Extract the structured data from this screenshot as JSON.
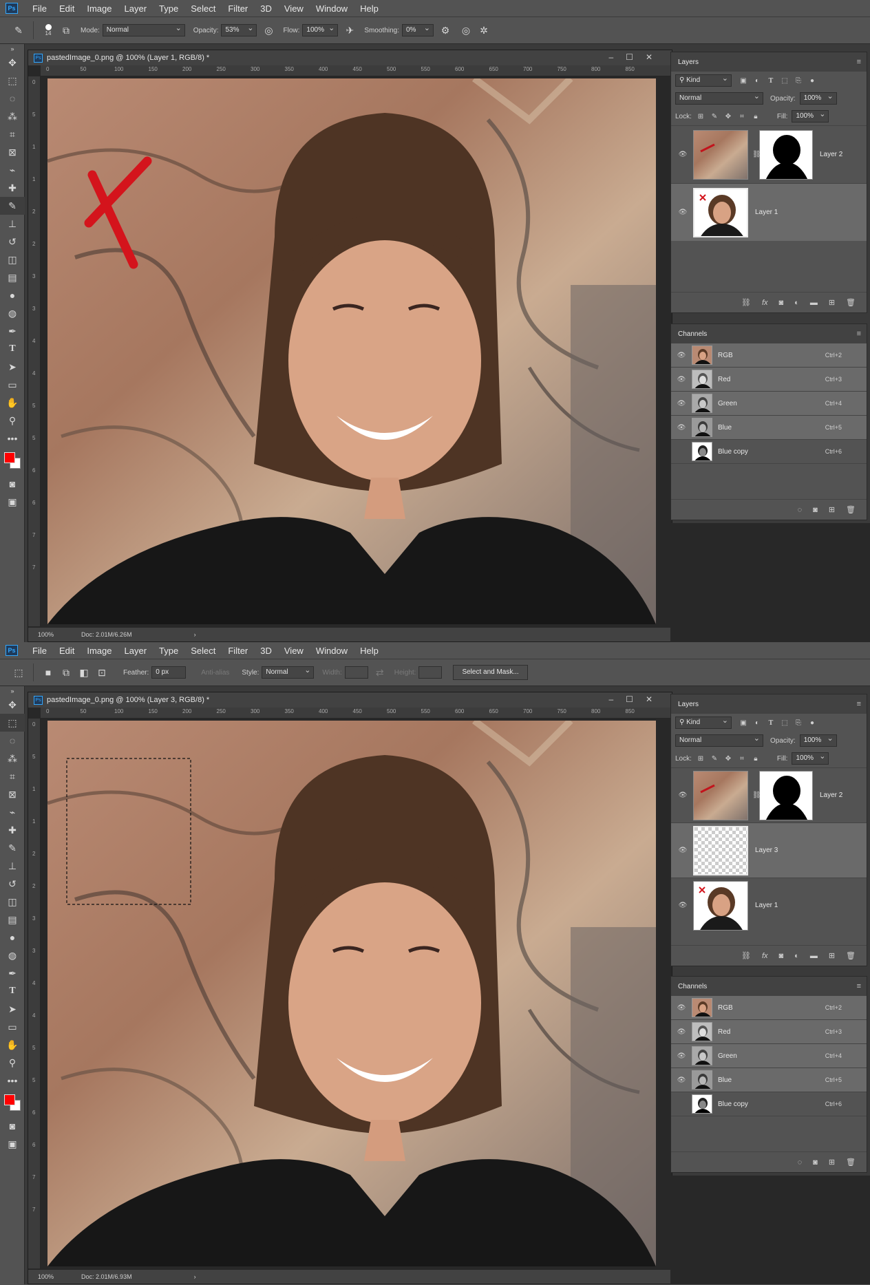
{
  "app_logo": "Ps",
  "menu": [
    "File",
    "Edit",
    "Image",
    "Layer",
    "Type",
    "Select",
    "Filter",
    "3D",
    "View",
    "Window",
    "Help"
  ],
  "ruler_h": [
    "0",
    "50",
    "100",
    "150",
    "200",
    "250",
    "300",
    "350",
    "400",
    "450",
    "500",
    "550",
    "600",
    "650",
    "700",
    "750",
    "800",
    "850"
  ],
  "ruler_v": [
    "0",
    "5",
    "1",
    "1",
    "2",
    "2",
    "3",
    "3",
    "4",
    "4",
    "5",
    "5",
    "6",
    "6",
    "7",
    "7"
  ],
  "panels": {
    "layers_tab": "Layers",
    "channels_tab": "Channels",
    "kind_label": "Kind",
    "blend_mode": "Normal",
    "opacity_label": "Opacity:",
    "opacity_value": "100%",
    "lock_label": "Lock:",
    "fill_label": "Fill:",
    "fill_value": "100%",
    "footer_icons": [
      "link-icon",
      "fx-icon",
      "mask-icon",
      "adjustment-icon",
      "folder-icon",
      "new-layer-icon",
      "trash-icon"
    ]
  },
  "window1": {
    "options": {
      "brush_size": "14",
      "mode_label": "Mode:",
      "mode_value": "Normal",
      "opacity_label": "Opacity:",
      "opacity_value": "53%",
      "flow_label": "Flow:",
      "flow_value": "100%",
      "smoothing_label": "Smoothing:",
      "smoothing_value": "0%"
    },
    "doc_title": "pastedImage_0.png @ 100% (Layer 1, RGB/8) *",
    "zoom": "100%",
    "doc_size": "Doc: 2.01M/6.26M",
    "layers": [
      {
        "name": "Layer 2",
        "thumb": "rock",
        "mask": true,
        "selected": false
      },
      {
        "name": "Layer 1",
        "thumb": "portrait",
        "mask": false,
        "selected": true
      }
    ],
    "channels": [
      {
        "name": "RGB",
        "shortcut": "Ctrl+2",
        "visible": true,
        "color": true
      },
      {
        "name": "Red",
        "shortcut": "Ctrl+3",
        "visible": true,
        "color": false
      },
      {
        "name": "Green",
        "shortcut": "Ctrl+4",
        "visible": true,
        "color": false
      },
      {
        "name": "Blue",
        "shortcut": "Ctrl+5",
        "visible": true,
        "color": false
      },
      {
        "name": "Blue copy",
        "shortcut": "Ctrl+6",
        "visible": false,
        "color": false
      }
    ]
  },
  "window2": {
    "options": {
      "feather_label": "Feather:",
      "feather_value": "0 px",
      "antialias_label": "Anti-alias",
      "style_label": "Style:",
      "style_value": "Normal",
      "width_label": "Width:",
      "height_label": "Height:",
      "select_mask_label": "Select and Mask..."
    },
    "doc_title": "pastedImage_0.png @ 100% (Layer 3, RGB/8) *",
    "zoom": "100%",
    "doc_size": "Doc: 2.01M/6.93M",
    "layers": [
      {
        "name": "Layer 2",
        "thumb": "rock",
        "mask": true,
        "selected": false
      },
      {
        "name": "Layer 3",
        "thumb": "transparent",
        "mask": false,
        "selected": true
      },
      {
        "name": "Layer 1",
        "thumb": "portrait",
        "mask": false,
        "selected": false
      }
    ],
    "channels": [
      {
        "name": "RGB",
        "shortcut": "Ctrl+2",
        "visible": true,
        "color": true
      },
      {
        "name": "Red",
        "shortcut": "Ctrl+3",
        "visible": true,
        "color": false
      },
      {
        "name": "Green",
        "shortcut": "Ctrl+4",
        "visible": true,
        "color": false
      },
      {
        "name": "Blue",
        "shortcut": "Ctrl+5",
        "visible": true,
        "color": false
      },
      {
        "name": "Blue copy",
        "shortcut": "Ctrl+6",
        "visible": false,
        "color": false
      }
    ]
  },
  "colors": {
    "foreground": "#ff0000",
    "background": "#ffffff",
    "app_bg": "#535353",
    "accent": "#31a8ff"
  }
}
